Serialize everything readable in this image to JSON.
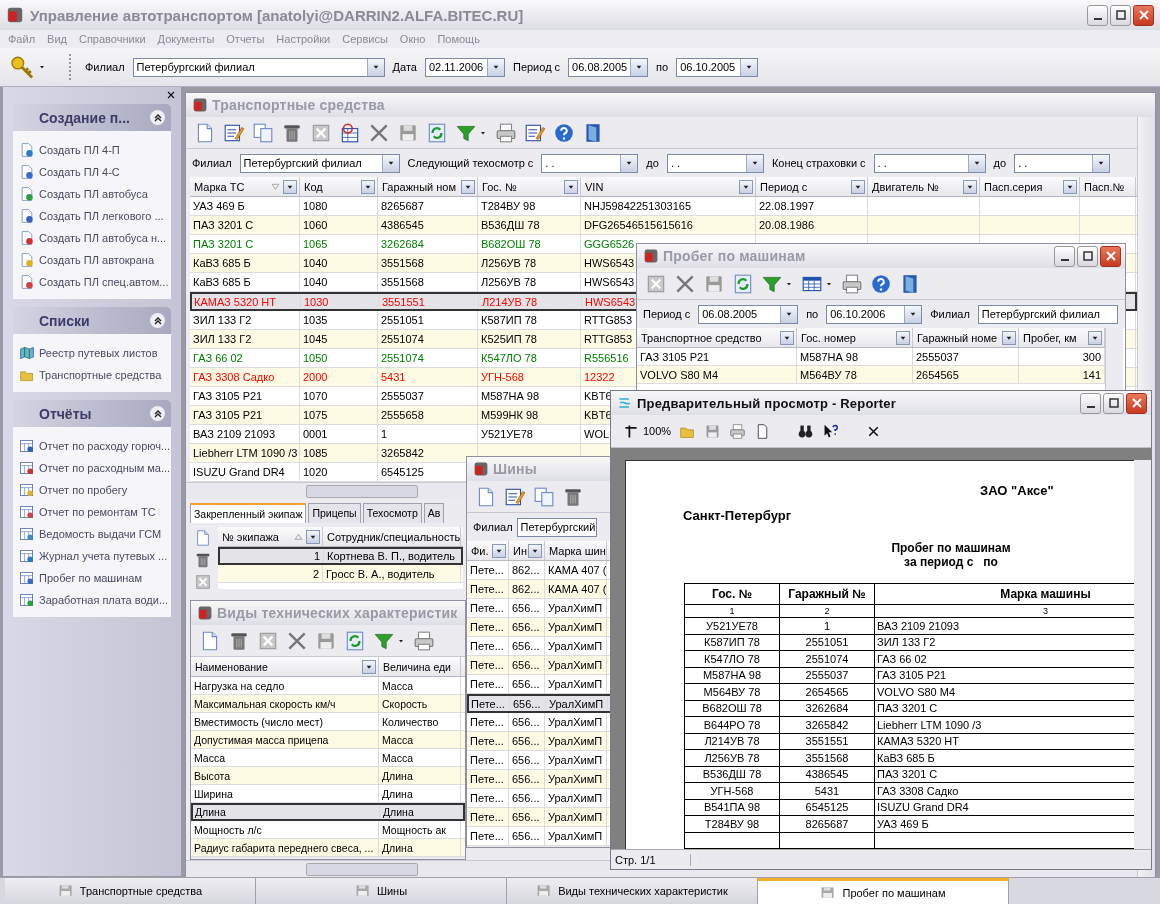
{
  "window": {
    "title": "Управление автотранспортом [anatolyi@DARRIN2.ALFA.BITEC.RU]"
  },
  "menu": [
    "Файл",
    "Вид",
    "Справочники",
    "Документы",
    "Отчеты",
    "Настройки",
    "Сервисы",
    "Окно",
    "Помощь"
  ],
  "toolbar": {
    "branch_label": "Филиал",
    "branch": "Петербургский филиал",
    "date_label": "Дата",
    "date": "02.11.2006",
    "from_label": "Период с",
    "from": "06.08.2005",
    "to_label": "по",
    "to": "06.10.2005"
  },
  "sidebar": {
    "groups": [
      {
        "title": "Создание п...",
        "expanded": true,
        "items": [
          "Создать ПЛ 4-П",
          "Создать ПЛ 4-С",
          "Создать ПЛ автобуса",
          "Создать ПЛ легкового ...",
          "Создать ПЛ автобуса н...",
          "Создать ПЛ автокрана",
          "Создать ПЛ спец.автом..."
        ]
      },
      {
        "title": "Списки",
        "expanded": true,
        "items": [
          "Реестр путевых листов",
          "Транспортные средства"
        ]
      },
      {
        "title": "Отчёты",
        "expanded": true,
        "items": [
          "Отчет по расходу горюч...",
          "Отчет по расходным ма...",
          "Отчет по пробегу",
          "Отчет по ремонтам ТС",
          "Ведомость выдачи ГСМ",
          "Журнал учета путевых ...",
          "Пробег по машинам",
          "Заработная плата води..."
        ]
      }
    ]
  },
  "vehicles": {
    "title": "Транспортные средства",
    "filters": [
      {
        "label": "Филиал",
        "value": "Петербургский филиал"
      },
      {
        "label": "Следующий техосмотр с",
        "value": ". ."
      },
      {
        "label": "до",
        "value": ". ."
      },
      {
        "label": "Конец страховки с",
        "value": ". ."
      },
      {
        "label": "до",
        "value": ". ."
      }
    ],
    "table": {
      "columns": [
        {
          "label": "Марка ТС",
          "sort_ascending": false,
          "filter": true
        },
        {
          "label": "Код",
          "filter": true
        },
        {
          "label": "Гаражный ном",
          "filter": true
        },
        {
          "label": "Гос. №",
          "filter": true
        },
        {
          "label": "VIN",
          "filter": true
        },
        {
          "label": "Период с",
          "filter": true
        },
        {
          "label": "Двигатель №",
          "filter": true
        },
        {
          "label": "Пасп.серия",
          "filter": true
        },
        {
          "label": "Пасп.№",
          "filter": false
        }
      ],
      "rows": [
        {
          "cells": [
            "УАЗ 469 Б",
            "1080",
            "8265687",
            "Т284ВУ 98",
            "NHJ59842251303165",
            "22.08.1997"
          ],
          "color": "#000000",
          "selected": false
        },
        {
          "cells": [
            "ПАЗ 3201 С",
            "1060",
            "4386545",
            "В536ДШ 78",
            "DFG26546515615616",
            "20.08.1986"
          ],
          "color": "#000000",
          "selected": false
        },
        {
          "cells": [
            "ПАЗ 3201 С",
            "1065",
            "3262684",
            "В682ОШ 78",
            "GGG6526"
          ],
          "color": "#008000",
          "selected": false
        },
        {
          "cells": [
            "КаВЗ 685 Б",
            "1040",
            "3551568",
            "Л256УВ 78",
            "HWS6543"
          ],
          "color": "#000000",
          "selected": false
        },
        {
          "cells": [
            "КаВЗ 685 Б",
            "1040",
            "3551568",
            "Л256УВ 78",
            "HWS6543"
          ],
          "color": "#000000",
          "selected": false
        },
        {
          "cells": [
            "КАМАЗ 5320 НТ",
            "1030",
            "3551551",
            "Л214УВ 78",
            "HWS6543"
          ],
          "color": "#ff0000",
          "selected": true
        },
        {
          "cells": [
            "ЗИЛ 133 Г2",
            "1035",
            "2551051",
            "К587ИП 78",
            "RTTG853"
          ],
          "color": "#000000",
          "selected": false
        },
        {
          "cells": [
            "ЗИЛ 133 Г2",
            "1045",
            "2551074",
            "К525ИП 78",
            "RTTG853"
          ],
          "color": "#000000",
          "selected": false
        },
        {
          "cells": [
            "ГАЗ 66 02",
            "1050",
            "2551074",
            "К547ЛО 78",
            "R556516"
          ],
          "color": "#008000",
          "selected": false
        },
        {
          "cells": [
            "ГАЗ 3308 Садко",
            "2000",
            "5431",
            "УГН-568",
            "12322"
          ],
          "color": "#ff0000",
          "selected": false
        },
        {
          "cells": [
            "ГАЗ 3105 Р21",
            "1070",
            "2555037",
            "М587НА 98",
            "KBT6"
          ],
          "color": "#000000",
          "selected": false
        },
        {
          "cells": [
            "ГАЗ 3105 Р21",
            "1075",
            "2555658",
            "М599НК 98",
            "KBT6"
          ],
          "color": "#000000",
          "selected": false
        },
        {
          "cells": [
            "ВАЗ 2109 21093",
            "0001",
            "1",
            "У521УЕ78",
            "WOL"
          ],
          "color": "#000000",
          "selected": false
        },
        {
          "cells": [
            "Liebherr LTM 1090 /3",
            "1085",
            "3265842"
          ],
          "color": "#000000",
          "selected": false
        },
        {
          "cells": [
            "ISUZU Grand DR4",
            "1020",
            "6545125"
          ],
          "color": "#000000",
          "selected": false
        }
      ]
    },
    "tabs": [
      {
        "label": "Закрепленный экипаж",
        "selected": true
      },
      {
        "label": "Прицепы",
        "selected": false
      },
      {
        "label": "Техосмотр",
        "selected": false
      },
      {
        "label": "Ав",
        "selected": false
      }
    ],
    "crew": {
      "columns": [
        {
          "label": "№ экипажа",
          "sort_ascending": true,
          "filter": true
        },
        {
          "label": "Сотрудник/специальность",
          "filter": false
        }
      ],
      "rows": [
        {
          "cells": [
            "1",
            "Кортнева В. П., водитель"
          ],
          "selected": true
        },
        {
          "cells": [
            "2",
            "Гросс В. А., водитель"
          ],
          "selected": false
        }
      ]
    }
  },
  "tech": {
    "title": "Виды технических характеристик",
    "table": {
      "columns": [
        {
          "label": "Наименование",
          "filter": true
        },
        {
          "label": "Величина еди",
          "filter": false
        }
      ],
      "rows": [
        {
          "cells": [
            "Нагрузка на седло",
            "Масса"
          ],
          "selected": false
        },
        {
          "cells": [
            "Максимальная скорость км/ч",
            "Скорость"
          ],
          "selected": false
        },
        {
          "cells": [
            "Вместимость (число мест)",
            "Количество"
          ],
          "selected": false
        },
        {
          "cells": [
            "Допустимая масса прицепа",
            "Масса"
          ],
          "selected": false
        },
        {
          "cells": [
            "Масса",
            "Масса"
          ],
          "selected": false
        },
        {
          "cells": [
            "Высота",
            "Длина"
          ],
          "selected": false
        },
        {
          "cells": [
            "Ширина",
            "Длина"
          ],
          "selected": false
        },
        {
          "cells": [
            "Длина",
            "Длина"
          ],
          "selected": true
        },
        {
          "cells": [
            "Мощность л/с",
            "Мощность ак"
          ],
          "selected": false
        },
        {
          "cells": [
            "Радиус габарита переднего свеса, ...",
            "Длина"
          ],
          "selected": false
        }
      ]
    }
  },
  "tires": {
    "title": "Шины",
    "branch_label": "Филиал",
    "branch": "Петербургский",
    "table": {
      "columns": [
        {
          "label": "Фи.",
          "filter": true
        },
        {
          "label": "Ин",
          "filter": true
        },
        {
          "label": "Марка шин",
          "filter": false
        }
      ],
      "rows": [
        {
          "cells": [
            "Пете...",
            "862...",
            "КАМА 407 ("
          ],
          "selected": false
        },
        {
          "cells": [
            "Пете...",
            "862...",
            "КАМА 407 ("
          ],
          "selected": false
        },
        {
          "cells": [
            "Пете...",
            "656...",
            "УралХимП"
          ],
          "selected": false
        },
        {
          "cells": [
            "Пете...",
            "656...",
            "УралХимП"
          ],
          "selected": false
        },
        {
          "cells": [
            "Пете...",
            "656...",
            "УралХимП"
          ],
          "selected": false
        },
        {
          "cells": [
            "Пете...",
            "656...",
            "УралХимП"
          ],
          "selected": false
        },
        {
          "cells": [
            "Пете...",
            "656...",
            "УралХимП"
          ],
          "selected": false
        },
        {
          "cells": [
            "Пете...",
            "656...",
            "УралХимП"
          ],
          "selected": true
        },
        {
          "cells": [
            "Пете...",
            "656...",
            "УралХимП"
          ],
          "selected": false
        },
        {
          "cells": [
            "Пете...",
            "656...",
            "УралХимП"
          ],
          "selected": false
        },
        {
          "cells": [
            "Пете...",
            "656...",
            "УралХимП"
          ],
          "selected": false
        },
        {
          "cells": [
            "Пете...",
            "656...",
            "УралХимП"
          ],
          "selected": false
        },
        {
          "cells": [
            "Пете...",
            "656...",
            "УралХимП"
          ],
          "selected": false
        },
        {
          "cells": [
            "Пете...",
            "656...",
            "УралХимП"
          ],
          "selected": false
        },
        {
          "cells": [
            "Пете...",
            "656...",
            "УралХимП"
          ],
          "selected": false
        }
      ]
    }
  },
  "mileage": {
    "title": "Пробег по машинам",
    "from_label": "Период с",
    "from": "06.08.2005",
    "to_label": "по",
    "to": "06.10.2006",
    "branch_label": "Филиал",
    "branch": "Петербургский филиал",
    "table": {
      "columns": [
        {
          "label": "Транспортное средство",
          "filter": true
        },
        {
          "label": "Гос. номер",
          "filter": true
        },
        {
          "label": "Гаражный номе",
          "filter": true
        },
        {
          "label": "Пробег, км",
          "filter": true
        }
      ],
      "rows": [
        {
          "cells": [
            "ГАЗ 3105 Р21",
            "М587НА 98",
            "2555037",
            "300"
          ]
        },
        {
          "cells": [
            "VOLVO S80 M4",
            "М564ВУ 78",
            "2654565",
            "141"
          ]
        }
      ]
    }
  },
  "reporter": {
    "title": "Предварительный просмотр - Reporter",
    "zoom": "100%",
    "company": "ЗАО \"Аксе\"",
    "city": "Санкт-Петербург",
    "heading": [
      "Пробег по машинам",
      "за период с   по"
    ],
    "columns": [
      "Гос. №",
      "Гаражный №",
      "Марка машины"
    ],
    "column_numbers": [
      "1",
      "2",
      "3"
    ],
    "rows": [
      [
        "У521УЕ78",
        "1",
        "ВАЗ 2109 21093"
      ],
      [
        "К587ИП 78",
        "2551051",
        "ЗИЛ 133 Г2"
      ],
      [
        "К547ЛО 78",
        "2551074",
        "ГАЗ 66 02"
      ],
      [
        "М587НА 98",
        "2555037",
        "ГАЗ 3105 Р21"
      ],
      [
        "М564ВУ 78",
        "2654565",
        "VOLVO S80 M4"
      ],
      [
        "В682ОШ 78",
        "3262684",
        "ПАЗ 3201 С"
      ],
      [
        "В644РО 78",
        "3265842",
        "Liebherr LTM 1090 /3"
      ],
      [
        "Л214УВ 78",
        "3551551",
        "КАМАЗ 5320 НТ"
      ],
      [
        "Л256УВ 78",
        "3551568",
        "КаВЗ 685 Б"
      ],
      [
        "В536ДШ 78",
        "4386545",
        "ПАЗ 3201 С"
      ],
      [
        "УГН-568",
        "5431",
        "ГАЗ 3308 Садко"
      ],
      [
        "В541ПА 98",
        "6545125",
        "ISUZU Grand DR4"
      ],
      [
        "Т284ВУ 98",
        "8265687",
        "УАЗ 469 Б"
      ]
    ],
    "status": "Стр. 1/1"
  },
  "taskbar": [
    {
      "label": "Транспортные средства",
      "selected": false
    },
    {
      "label": "Шины",
      "selected": false
    },
    {
      "label": "Виды технических характеристик",
      "selected": false
    },
    {
      "label": "Пробег по машинам",
      "selected": true
    }
  ]
}
